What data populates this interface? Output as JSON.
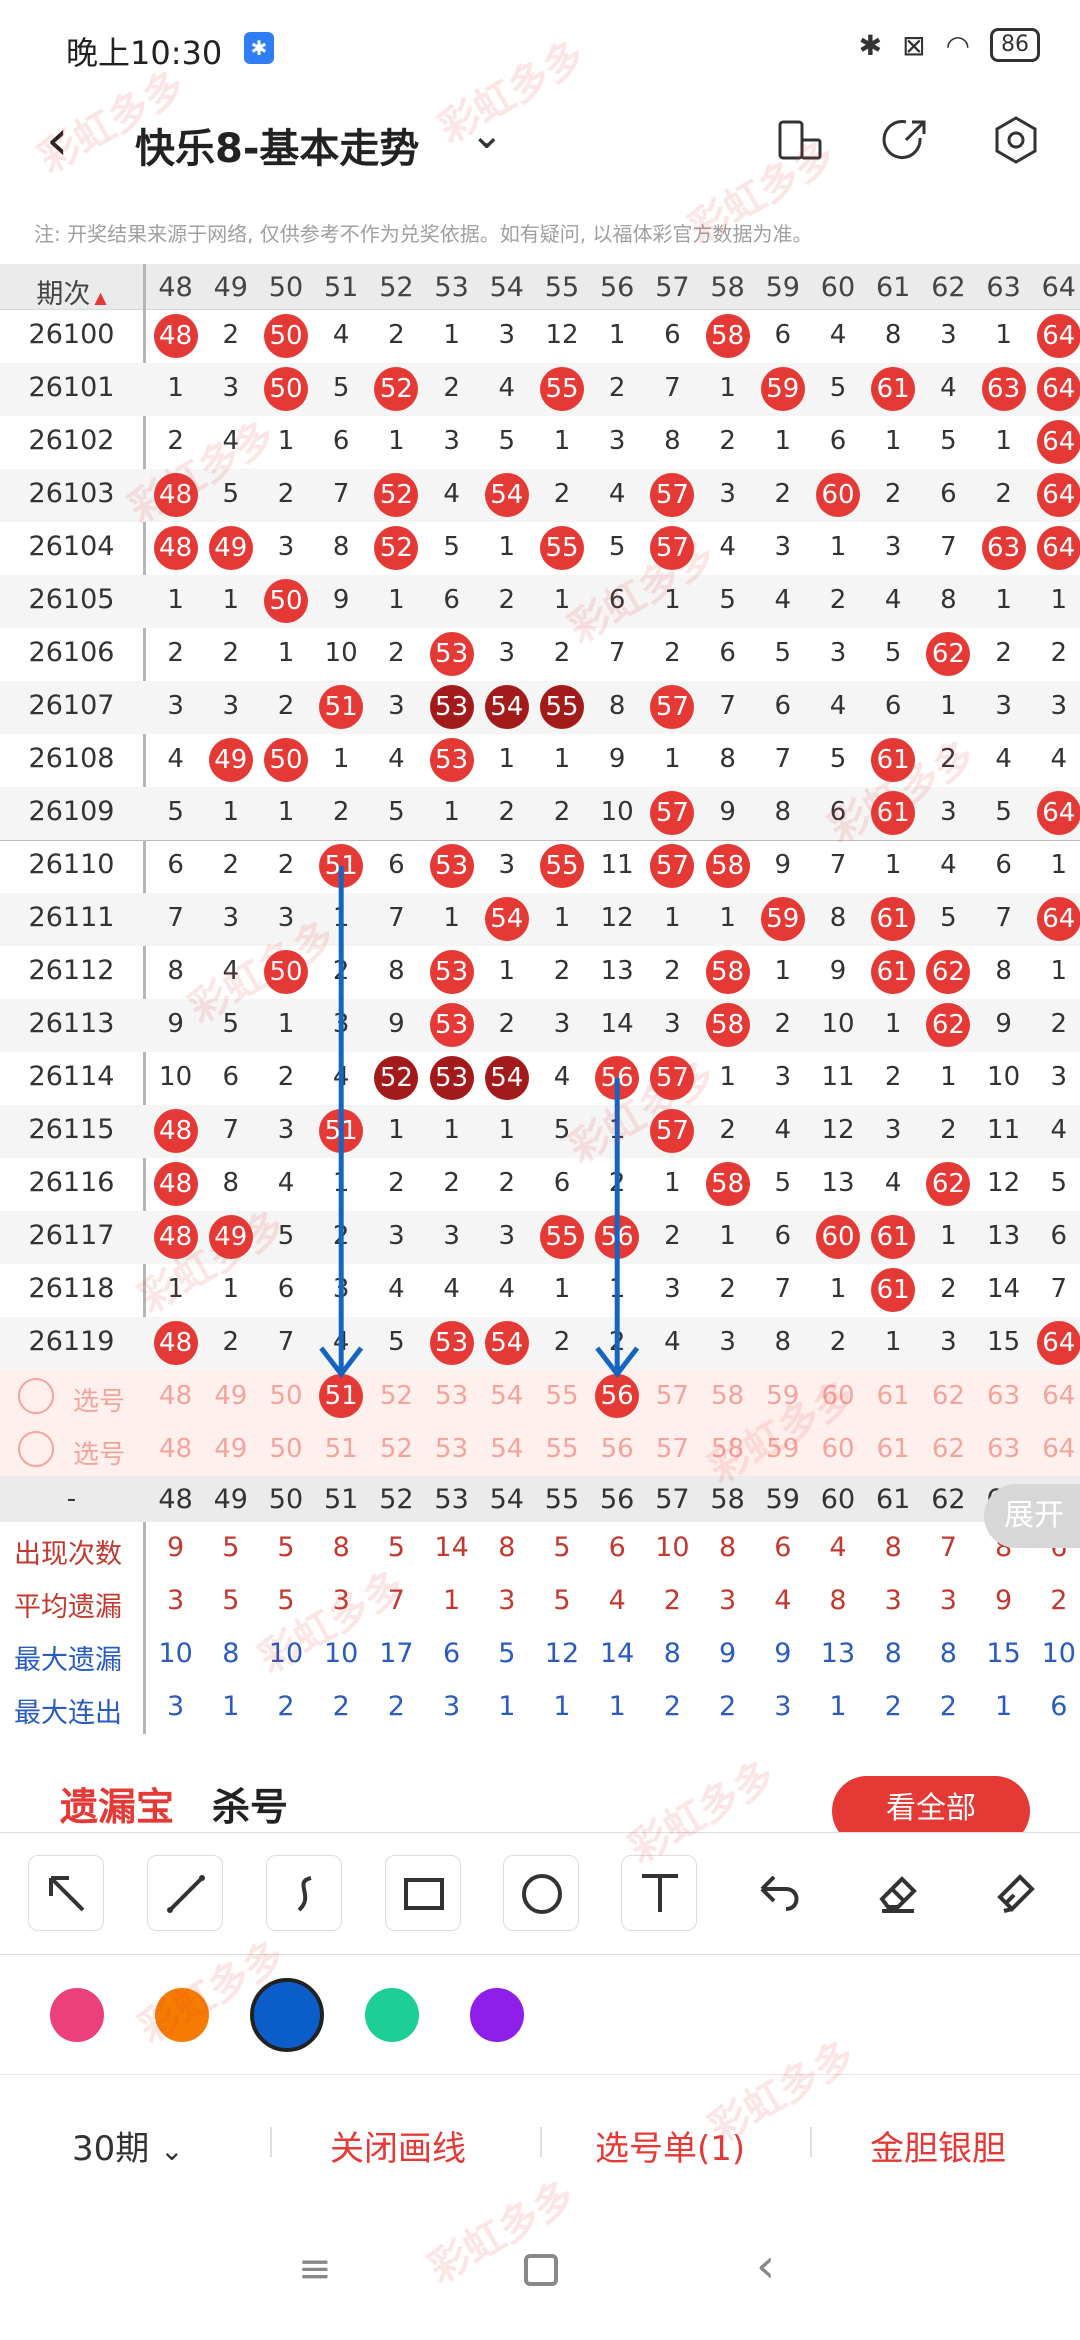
{
  "status_bar": {
    "time": "晚上10:30",
    "battery": "86"
  },
  "header": {
    "title": "快乐8-基本走势"
  },
  "note": "注: 开奖结果来源于网络, 仅供参考不作为兑奖依据。如有疑问, 以福体彩官方数据为准。",
  "table": {
    "period_header": "期次",
    "columns": [
      "48",
      "49",
      "50",
      "51",
      "52",
      "53",
      "54",
      "55",
      "56",
      "57",
      "58",
      "59",
      "60",
      "61",
      "62",
      "63",
      "64"
    ],
    "rows": [
      {
        "period": "26100",
        "cells": [
          "48",
          "2",
          "50",
          "4",
          "2",
          "1",
          "3",
          "12",
          "1",
          "6",
          "58",
          "6",
          "4",
          "8",
          "3",
          "1",
          "64"
        ],
        "hits": [
          1,
          0,
          1,
          0,
          0,
          0,
          0,
          0,
          0,
          0,
          1,
          0,
          0,
          0,
          0,
          0,
          1
        ]
      },
      {
        "period": "26101",
        "cells": [
          "1",
          "3",
          "50",
          "5",
          "52",
          "2",
          "4",
          "55",
          "2",
          "7",
          "1",
          "59",
          "5",
          "61",
          "4",
          "63",
          "64"
        ],
        "hits": [
          0,
          0,
          1,
          0,
          1,
          0,
          0,
          1,
          0,
          0,
          0,
          1,
          0,
          1,
          0,
          1,
          1
        ]
      },
      {
        "period": "26102",
        "cells": [
          "2",
          "4",
          "1",
          "6",
          "1",
          "3",
          "5",
          "1",
          "3",
          "8",
          "2",
          "1",
          "6",
          "1",
          "5",
          "1",
          "64"
        ],
        "hits": [
          0,
          0,
          0,
          0,
          0,
          0,
          0,
          0,
          0,
          0,
          0,
          0,
          0,
          0,
          0,
          0,
          1
        ]
      },
      {
        "period": "26103",
        "cells": [
          "48",
          "5",
          "2",
          "7",
          "52",
          "4",
          "54",
          "2",
          "4",
          "57",
          "3",
          "2",
          "60",
          "2",
          "6",
          "2",
          "64"
        ],
        "hits": [
          1,
          0,
          0,
          0,
          1,
          0,
          1,
          0,
          0,
          1,
          0,
          0,
          1,
          0,
          0,
          0,
          1
        ]
      },
      {
        "period": "26104",
        "cells": [
          "48",
          "49",
          "3",
          "8",
          "52",
          "5",
          "1",
          "55",
          "5",
          "57",
          "4",
          "3",
          "1",
          "3",
          "7",
          "63",
          "64"
        ],
        "hits": [
          1,
          1,
          0,
          0,
          1,
          0,
          0,
          1,
          0,
          1,
          0,
          0,
          0,
          0,
          0,
          1,
          1
        ]
      },
      {
        "period": "26105",
        "cells": [
          "1",
          "1",
          "50",
          "9",
          "1",
          "6",
          "2",
          "1",
          "6",
          "1",
          "5",
          "4",
          "2",
          "4",
          "8",
          "1",
          "1"
        ],
        "hits": [
          0,
          0,
          1,
          0,
          0,
          0,
          0,
          0,
          0,
          0,
          0,
          0,
          0,
          0,
          0,
          0,
          0
        ]
      },
      {
        "period": "26106",
        "cells": [
          "2",
          "2",
          "1",
          "10",
          "2",
          "53",
          "3",
          "2",
          "7",
          "2",
          "6",
          "5",
          "3",
          "5",
          "62",
          "2",
          "2"
        ],
        "hits": [
          0,
          0,
          0,
          0,
          0,
          1,
          0,
          0,
          0,
          0,
          0,
          0,
          0,
          0,
          1,
          0,
          0
        ]
      },
      {
        "period": "26107",
        "cells": [
          "3",
          "3",
          "2",
          "51",
          "3",
          "53",
          "54",
          "55",
          "8",
          "57",
          "7",
          "6",
          "4",
          "6",
          "1",
          "3",
          "3"
        ],
        "hits": [
          0,
          0,
          0,
          1,
          0,
          2,
          2,
          2,
          0,
          1,
          0,
          0,
          0,
          0,
          0,
          0,
          0
        ]
      },
      {
        "period": "26108",
        "cells": [
          "4",
          "49",
          "50",
          "1",
          "4",
          "53",
          "1",
          "1",
          "9",
          "1",
          "8",
          "7",
          "5",
          "61",
          "2",
          "4",
          "4"
        ],
        "hits": [
          0,
          1,
          1,
          0,
          0,
          1,
          0,
          0,
          0,
          0,
          0,
          0,
          0,
          1,
          0,
          0,
          0
        ]
      },
      {
        "period": "26109",
        "cells": [
          "5",
          "1",
          "1",
          "2",
          "5",
          "1",
          "2",
          "2",
          "10",
          "57",
          "9",
          "8",
          "6",
          "61",
          "3",
          "5",
          "64"
        ],
        "hits": [
          0,
          0,
          0,
          0,
          0,
          0,
          0,
          0,
          0,
          1,
          0,
          0,
          0,
          1,
          0,
          0,
          1
        ]
      },
      {
        "period": "26110",
        "cells": [
          "6",
          "2",
          "2",
          "51",
          "6",
          "53",
          "3",
          "55",
          "11",
          "57",
          "58",
          "9",
          "7",
          "1",
          "4",
          "6",
          "1"
        ],
        "hits": [
          0,
          0,
          0,
          1,
          0,
          1,
          0,
          1,
          0,
          1,
          1,
          0,
          0,
          0,
          0,
          0,
          0
        ]
      },
      {
        "period": "26111",
        "cells": [
          "7",
          "3",
          "3",
          "1",
          "7",
          "1",
          "54",
          "1",
          "12",
          "1",
          "1",
          "59",
          "8",
          "61",
          "5",
          "7",
          "64"
        ],
        "hits": [
          0,
          0,
          0,
          0,
          0,
          0,
          1,
          0,
          0,
          0,
          0,
          1,
          0,
          1,
          0,
          0,
          1
        ]
      },
      {
        "period": "26112",
        "cells": [
          "8",
          "4",
          "50",
          "2",
          "8",
          "53",
          "1",
          "2",
          "13",
          "2",
          "58",
          "1",
          "9",
          "61",
          "62",
          "8",
          "1"
        ],
        "hits": [
          0,
          0,
          1,
          0,
          0,
          1,
          0,
          0,
          0,
          0,
          1,
          0,
          0,
          1,
          1,
          0,
          0
        ]
      },
      {
        "period": "26113",
        "cells": [
          "9",
          "5",
          "1",
          "3",
          "9",
          "53",
          "2",
          "3",
          "14",
          "3",
          "58",
          "2",
          "10",
          "1",
          "62",
          "9",
          "2"
        ],
        "hits": [
          0,
          0,
          0,
          0,
          0,
          1,
          0,
          0,
          0,
          0,
          1,
          0,
          0,
          0,
          1,
          0,
          0
        ]
      },
      {
        "period": "26114",
        "cells": [
          "10",
          "6",
          "2",
          "4",
          "52",
          "53",
          "54",
          "4",
          "56",
          "57",
          "1",
          "3",
          "11",
          "2",
          "1",
          "10",
          "3"
        ],
        "hits": [
          0,
          0,
          0,
          0,
          2,
          2,
          2,
          0,
          1,
          1,
          0,
          0,
          0,
          0,
          0,
          0,
          0
        ]
      },
      {
        "period": "26115",
        "cells": [
          "48",
          "7",
          "3",
          "51",
          "1",
          "1",
          "1",
          "5",
          "1",
          "57",
          "2",
          "4",
          "12",
          "3",
          "2",
          "11",
          "4"
        ],
        "hits": [
          1,
          0,
          0,
          1,
          0,
          0,
          0,
          0,
          0,
          1,
          0,
          0,
          0,
          0,
          0,
          0,
          0
        ]
      },
      {
        "period": "26116",
        "cells": [
          "48",
          "8",
          "4",
          "1",
          "2",
          "2",
          "2",
          "6",
          "2",
          "1",
          "58",
          "5",
          "13",
          "4",
          "62",
          "12",
          "5"
        ],
        "hits": [
          1,
          0,
          0,
          0,
          0,
          0,
          0,
          0,
          0,
          0,
          1,
          0,
          0,
          0,
          1,
          0,
          0
        ]
      },
      {
        "period": "26117",
        "cells": [
          "48",
          "49",
          "5",
          "2",
          "3",
          "3",
          "3",
          "55",
          "56",
          "2",
          "1",
          "6",
          "60",
          "61",
          "1",
          "13",
          "6"
        ],
        "hits": [
          1,
          1,
          0,
          0,
          0,
          0,
          0,
          1,
          1,
          0,
          0,
          0,
          1,
          1,
          0,
          0,
          0
        ]
      },
      {
        "period": "26118",
        "cells": [
          "1",
          "1",
          "6",
          "3",
          "4",
          "4",
          "4",
          "1",
          "1",
          "3",
          "2",
          "7",
          "1",
          "61",
          "2",
          "14",
          "7"
        ],
        "hits": [
          0,
          0,
          0,
          0,
          0,
          0,
          0,
          0,
          0,
          0,
          0,
          0,
          0,
          1,
          0,
          0,
          0
        ]
      },
      {
        "period": "26119",
        "cells": [
          "48",
          "2",
          "7",
          "4",
          "5",
          "53",
          "54",
          "2",
          "2",
          "4",
          "3",
          "8",
          "2",
          "1",
          "3",
          "15",
          "64"
        ],
        "hits": [
          1,
          0,
          0,
          0,
          0,
          1,
          1,
          0,
          0,
          0,
          0,
          0,
          0,
          0,
          0,
          0,
          1
        ]
      }
    ],
    "selection_label": "选号",
    "selected_numbers": [
      "51",
      "56"
    ],
    "footer_dash": "-",
    "stats": [
      {
        "label": "出现次数",
        "color": "#c23a2f",
        "values": [
          "9",
          "5",
          "5",
          "8",
          "5",
          "14",
          "8",
          "5",
          "6",
          "10",
          "8",
          "6",
          "4",
          "8",
          "7",
          "8",
          "6"
        ]
      },
      {
        "label": "平均遗漏",
        "color": "#c23a2f",
        "values": [
          "3",
          "5",
          "5",
          "3",
          "7",
          "1",
          "3",
          "5",
          "4",
          "2",
          "3",
          "4",
          "8",
          "3",
          "3",
          "9",
          "2"
        ]
      },
      {
        "label": "最大遗漏",
        "color": "#2a5bbf",
        "values": [
          "10",
          "8",
          "10",
          "10",
          "17",
          "6",
          "5",
          "12",
          "14",
          "8",
          "9",
          "9",
          "13",
          "8",
          "8",
          "15",
          "10"
        ]
      },
      {
        "label": "最大连出",
        "color": "#2a5bbf",
        "values": [
          "3",
          "1",
          "2",
          "2",
          "2",
          "3",
          "1",
          "1",
          "1",
          "2",
          "2",
          "3",
          "1",
          "2",
          "2",
          "1",
          "6"
        ]
      }
    ],
    "expand_label": "展开"
  },
  "promo": {
    "title_red": "遗漏宝",
    "title_black": "杀号",
    "button": "看全部"
  },
  "draw_tools": [
    "arrow-tool",
    "line-tool",
    "curve-tool",
    "rectangle-tool",
    "circle-tool",
    "text-tool",
    "undo-tool",
    "eraser-tool",
    "clear-tool"
  ],
  "colors": [
    "#ec407a",
    "#f57c00",
    "#0b5ec9",
    "#1dcf94",
    "#8e1ee8"
  ],
  "bottom_bar": {
    "period_select": "30期",
    "close_line": "关闭画线",
    "selection_list": "选号单(1)",
    "golden": "金胆银胆"
  },
  "watermark": "彩虹多多"
}
